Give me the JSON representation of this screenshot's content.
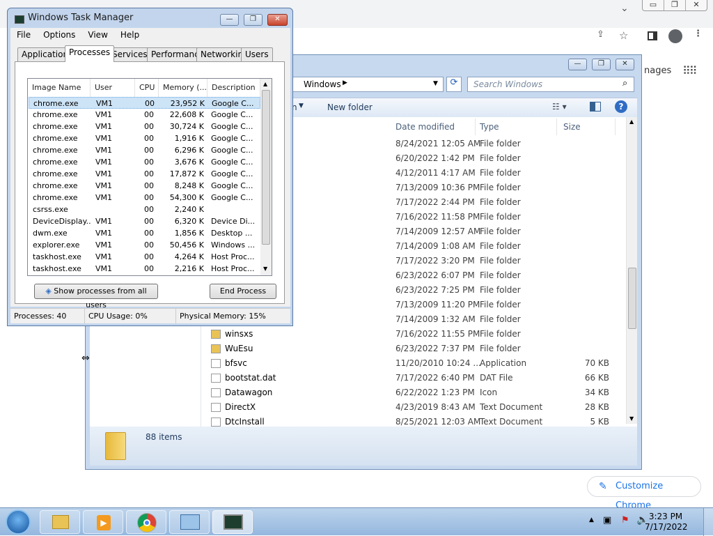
{
  "chrome": {
    "images_link": "nages",
    "customize_label": "Customize Chrome"
  },
  "explorer": {
    "breadcrumb": "Windows",
    "search_placeholder": "Search Windows",
    "toolbar_partial": "n",
    "new_folder": "New folder",
    "columns": {
      "date": "Date modified",
      "type": "Type",
      "size": "Size"
    },
    "partial_name": "on",
    "rows": [
      {
        "name": "",
        "date": "8/24/2021 12:05 AM",
        "type": "File folder",
        "size": ""
      },
      {
        "name": "",
        "date": "6/20/2022 1:42 PM",
        "type": "File folder",
        "size": ""
      },
      {
        "name": "",
        "date": "4/12/2011 4:17 AM",
        "type": "File folder",
        "size": ""
      },
      {
        "name": "",
        "date": "7/13/2009 10:36 PM",
        "type": "File folder",
        "size": ""
      },
      {
        "name": "",
        "date": "7/17/2022 2:44 PM",
        "type": "File folder",
        "size": ""
      },
      {
        "name": "",
        "date": "7/16/2022 11:58 PM",
        "type": "File folder",
        "size": ""
      },
      {
        "name": "",
        "date": "7/14/2009 12:57 AM",
        "type": "File folder",
        "size": ""
      },
      {
        "name": "",
        "date": "7/14/2009 1:08 AM",
        "type": "File folder",
        "size": ""
      },
      {
        "name": "",
        "date": "7/17/2022 3:20 PM",
        "type": "File folder",
        "size": ""
      },
      {
        "name": "",
        "date": "6/23/2022 6:07 PM",
        "type": "File folder",
        "size": ""
      },
      {
        "name": "",
        "date": "6/23/2022 7:25 PM",
        "type": "File folder",
        "size": ""
      },
      {
        "name": "",
        "date": "7/13/2009 11:20 PM",
        "type": "File folder",
        "size": ""
      },
      {
        "name": "",
        "date": "7/14/2009 1:32 AM",
        "type": "File folder",
        "size": ""
      },
      {
        "name": "winsxs",
        "date": "7/16/2022 11:55 PM",
        "type": "File folder",
        "size": ""
      },
      {
        "name": "WuEsu",
        "date": "6/23/2022 7:37 PM",
        "type": "File folder",
        "size": ""
      },
      {
        "name": "bfsvc",
        "date": "11/20/2010 10:24 ...",
        "type": "Application",
        "size": "70 KB"
      },
      {
        "name": "bootstat.dat",
        "date": "7/17/2022 6:40 PM",
        "type": "DAT File",
        "size": "66 KB"
      },
      {
        "name": "Datawagon",
        "date": "6/22/2022 1:23 PM",
        "type": "Icon",
        "size": "34 KB"
      },
      {
        "name": "DirectX",
        "date": "4/23/2019 8:43 AM",
        "type": "Text Document",
        "size": "28 KB"
      },
      {
        "name": "DtcInstall",
        "date": "8/25/2021 12:03 AM",
        "type": "Text Document",
        "size": "5 KB"
      }
    ],
    "item_count": "88 items"
  },
  "taskmgr": {
    "title": "Windows Task Manager",
    "menu": [
      "File",
      "Options",
      "View",
      "Help"
    ],
    "tabs": [
      "Applications",
      "Processes",
      "Services",
      "Performance",
      "Networking",
      "Users"
    ],
    "columns": [
      "Image Name",
      "User Name",
      "CPU",
      "Memory (...",
      "Description"
    ],
    "processes": [
      {
        "name": "chrome.exe",
        "user": "VM1",
        "cpu": "00",
        "mem": "23,952 K",
        "desc": "Google C..."
      },
      {
        "name": "chrome.exe",
        "user": "VM1",
        "cpu": "00",
        "mem": "22,608 K",
        "desc": "Google C..."
      },
      {
        "name": "chrome.exe",
        "user": "VM1",
        "cpu": "00",
        "mem": "30,724 K",
        "desc": "Google C..."
      },
      {
        "name": "chrome.exe",
        "user": "VM1",
        "cpu": "00",
        "mem": "1,916 K",
        "desc": "Google C..."
      },
      {
        "name": "chrome.exe",
        "user": "VM1",
        "cpu": "00",
        "mem": "6,296 K",
        "desc": "Google C..."
      },
      {
        "name": "chrome.exe",
        "user": "VM1",
        "cpu": "00",
        "mem": "3,676 K",
        "desc": "Google C..."
      },
      {
        "name": "chrome.exe",
        "user": "VM1",
        "cpu": "00",
        "mem": "17,872 K",
        "desc": "Google C..."
      },
      {
        "name": "chrome.exe",
        "user": "VM1",
        "cpu": "00",
        "mem": "8,248 K",
        "desc": "Google C..."
      },
      {
        "name": "chrome.exe",
        "user": "VM1",
        "cpu": "00",
        "mem": "54,300 K",
        "desc": "Google C..."
      },
      {
        "name": "csrss.exe",
        "user": "",
        "cpu": "00",
        "mem": "2,240 K",
        "desc": ""
      },
      {
        "name": "DeviceDisplay...",
        "user": "VM1",
        "cpu": "00",
        "mem": "6,320 K",
        "desc": "Device Di..."
      },
      {
        "name": "dwm.exe",
        "user": "VM1",
        "cpu": "00",
        "mem": "1,856 K",
        "desc": "Desktop ..."
      },
      {
        "name": "explorer.exe",
        "user": "VM1",
        "cpu": "00",
        "mem": "50,456 K",
        "desc": "Windows ..."
      },
      {
        "name": "taskhost.exe",
        "user": "VM1",
        "cpu": "00",
        "mem": "4,264 K",
        "desc": "Host Proc..."
      },
      {
        "name": "taskhost.exe",
        "user": "VM1",
        "cpu": "00",
        "mem": "2,216 K",
        "desc": "Host Proc..."
      }
    ],
    "show_all_label": "Show processes from all users",
    "end_process_label": "End Process",
    "status": {
      "processes": "Processes: 40",
      "cpu": "CPU Usage: 0%",
      "memory": "Physical Memory: 15%"
    }
  },
  "taskbar": {
    "time": "3:23 PM",
    "date": "7/17/2022"
  }
}
